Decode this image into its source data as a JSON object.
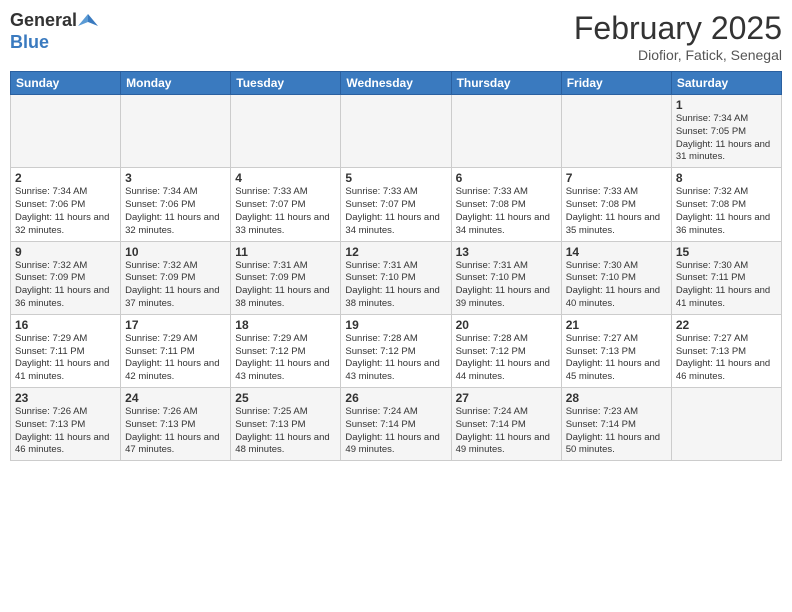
{
  "logo": {
    "general": "General",
    "blue": "Blue"
  },
  "header": {
    "month": "February 2025",
    "location": "Diofior, Fatick, Senegal"
  },
  "weekdays": [
    "Sunday",
    "Monday",
    "Tuesday",
    "Wednesday",
    "Thursday",
    "Friday",
    "Saturday"
  ],
  "weeks": [
    [
      {
        "day": "",
        "info": ""
      },
      {
        "day": "",
        "info": ""
      },
      {
        "day": "",
        "info": ""
      },
      {
        "day": "",
        "info": ""
      },
      {
        "day": "",
        "info": ""
      },
      {
        "day": "",
        "info": ""
      },
      {
        "day": "1",
        "info": "Sunrise: 7:34 AM\nSunset: 7:05 PM\nDaylight: 11 hours and 31 minutes."
      }
    ],
    [
      {
        "day": "2",
        "info": "Sunrise: 7:34 AM\nSunset: 7:06 PM\nDaylight: 11 hours and 32 minutes."
      },
      {
        "day": "3",
        "info": "Sunrise: 7:34 AM\nSunset: 7:06 PM\nDaylight: 11 hours and 32 minutes."
      },
      {
        "day": "4",
        "info": "Sunrise: 7:33 AM\nSunset: 7:07 PM\nDaylight: 11 hours and 33 minutes."
      },
      {
        "day": "5",
        "info": "Sunrise: 7:33 AM\nSunset: 7:07 PM\nDaylight: 11 hours and 34 minutes."
      },
      {
        "day": "6",
        "info": "Sunrise: 7:33 AM\nSunset: 7:08 PM\nDaylight: 11 hours and 34 minutes."
      },
      {
        "day": "7",
        "info": "Sunrise: 7:33 AM\nSunset: 7:08 PM\nDaylight: 11 hours and 35 minutes."
      },
      {
        "day": "8",
        "info": "Sunrise: 7:32 AM\nSunset: 7:08 PM\nDaylight: 11 hours and 36 minutes."
      }
    ],
    [
      {
        "day": "9",
        "info": "Sunrise: 7:32 AM\nSunset: 7:09 PM\nDaylight: 11 hours and 36 minutes."
      },
      {
        "day": "10",
        "info": "Sunrise: 7:32 AM\nSunset: 7:09 PM\nDaylight: 11 hours and 37 minutes."
      },
      {
        "day": "11",
        "info": "Sunrise: 7:31 AM\nSunset: 7:09 PM\nDaylight: 11 hours and 38 minutes."
      },
      {
        "day": "12",
        "info": "Sunrise: 7:31 AM\nSunset: 7:10 PM\nDaylight: 11 hours and 38 minutes."
      },
      {
        "day": "13",
        "info": "Sunrise: 7:31 AM\nSunset: 7:10 PM\nDaylight: 11 hours and 39 minutes."
      },
      {
        "day": "14",
        "info": "Sunrise: 7:30 AM\nSunset: 7:10 PM\nDaylight: 11 hours and 40 minutes."
      },
      {
        "day": "15",
        "info": "Sunrise: 7:30 AM\nSunset: 7:11 PM\nDaylight: 11 hours and 41 minutes."
      }
    ],
    [
      {
        "day": "16",
        "info": "Sunrise: 7:29 AM\nSunset: 7:11 PM\nDaylight: 11 hours and 41 minutes."
      },
      {
        "day": "17",
        "info": "Sunrise: 7:29 AM\nSunset: 7:11 PM\nDaylight: 11 hours and 42 minutes."
      },
      {
        "day": "18",
        "info": "Sunrise: 7:29 AM\nSunset: 7:12 PM\nDaylight: 11 hours and 43 minutes."
      },
      {
        "day": "19",
        "info": "Sunrise: 7:28 AM\nSunset: 7:12 PM\nDaylight: 11 hours and 43 minutes."
      },
      {
        "day": "20",
        "info": "Sunrise: 7:28 AM\nSunset: 7:12 PM\nDaylight: 11 hours and 44 minutes."
      },
      {
        "day": "21",
        "info": "Sunrise: 7:27 AM\nSunset: 7:13 PM\nDaylight: 11 hours and 45 minutes."
      },
      {
        "day": "22",
        "info": "Sunrise: 7:27 AM\nSunset: 7:13 PM\nDaylight: 11 hours and 46 minutes."
      }
    ],
    [
      {
        "day": "23",
        "info": "Sunrise: 7:26 AM\nSunset: 7:13 PM\nDaylight: 11 hours and 46 minutes."
      },
      {
        "day": "24",
        "info": "Sunrise: 7:26 AM\nSunset: 7:13 PM\nDaylight: 11 hours and 47 minutes."
      },
      {
        "day": "25",
        "info": "Sunrise: 7:25 AM\nSunset: 7:13 PM\nDaylight: 11 hours and 48 minutes."
      },
      {
        "day": "26",
        "info": "Sunrise: 7:24 AM\nSunset: 7:14 PM\nDaylight: 11 hours and 49 minutes."
      },
      {
        "day": "27",
        "info": "Sunrise: 7:24 AM\nSunset: 7:14 PM\nDaylight: 11 hours and 49 minutes."
      },
      {
        "day": "28",
        "info": "Sunrise: 7:23 AM\nSunset: 7:14 PM\nDaylight: 11 hours and 50 minutes."
      },
      {
        "day": "",
        "info": ""
      }
    ]
  ]
}
